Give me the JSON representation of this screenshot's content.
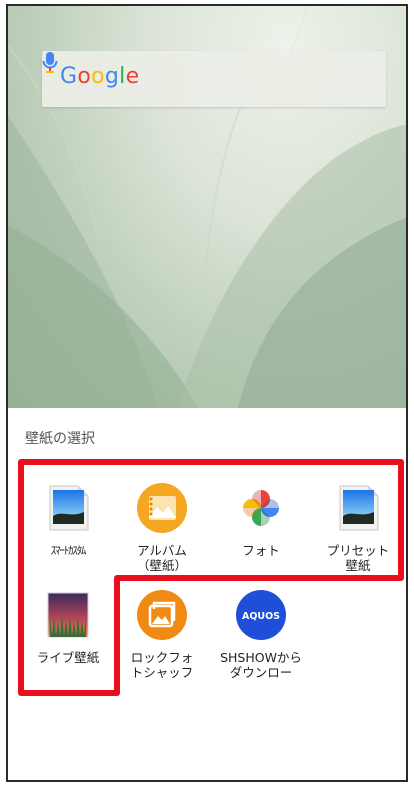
{
  "wallpaper": {
    "search_bar": {
      "logo_letters": [
        {
          "ch": "G",
          "color": "#4285F4"
        },
        {
          "ch": "o",
          "color": "#EA4335"
        },
        {
          "ch": "o",
          "color": "#FBBC05"
        },
        {
          "ch": "g",
          "color": "#4285F4"
        },
        {
          "ch": "l",
          "color": "#34A853"
        },
        {
          "ch": "e",
          "color": "#EA4335"
        }
      ],
      "mic_icon": "microphone-icon"
    }
  },
  "sheet": {
    "title": "壁紙の選択",
    "apps": [
      {
        "label": "ｽﾏｰﾄｶｽﾀﾑ",
        "icon": "image-file-icon"
      },
      {
        "label": "アルバム\n（壁紙）",
        "icon": "album-icon"
      },
      {
        "label": "フォト",
        "icon": "google-photos-pinwheel-icon"
      },
      {
        "label": "プリセット\n壁紙",
        "icon": "image-file-icon"
      },
      {
        "label": "ライブ壁紙",
        "icon": "live-wallpaper-icon"
      },
      {
        "label": "ロックフォ\nトシャッフ",
        "icon": "lock-photo-shuffle-icon"
      },
      {
        "label": "SHSHOWから\nダウンロー",
        "icon": "aquos-icon",
        "icon_text": "AQUOS"
      }
    ]
  },
  "colors": {
    "highlight": "#e8101e",
    "album_orange": "#f5a623",
    "shuffle_orange": "#ef8a14",
    "aquos_blue": "#1f4fd8"
  }
}
